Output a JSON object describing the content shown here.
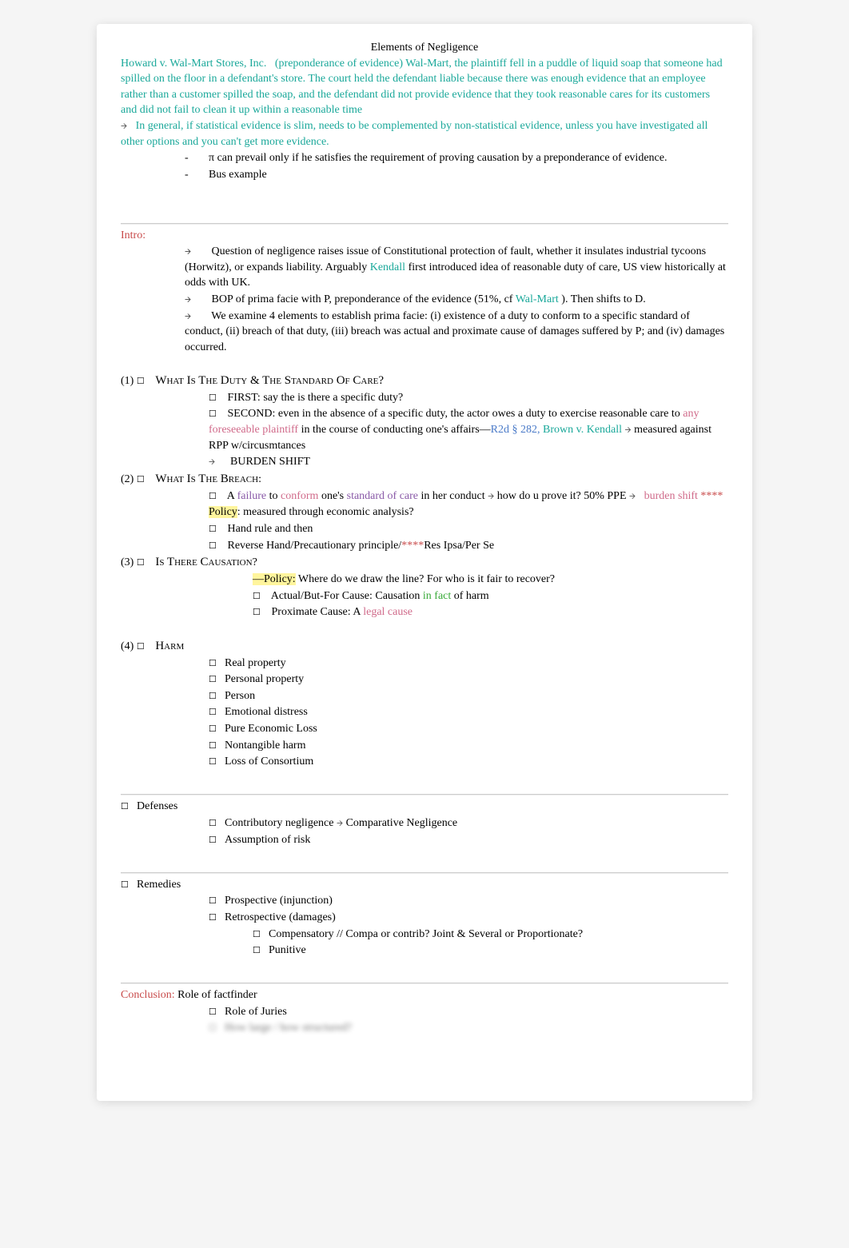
{
  "title": "Elements of Negligence",
  "case_lead": {
    "name": "Howard v. Wal-Mart Stores, Inc.",
    "tag": "(preponderance of evidence)",
    "body": "Wal-Mart, the plaintiff fell in a puddle of liquid soap that someone had spilled on the floor in a defendant's store. The court held the defendant liable because there was enough evidence that an employee rather than a customer spilled the soap, and the defendant did not provide evidence that they took reasonable cares for its customers and did not fail to clean it up within a reasonable time"
  },
  "teal_rule": "In general, if statistical evidence is slim, needs to be complemented by non-statistical evidence, unless you have investigated all other options and you can't get more evidence.",
  "dash_items": [
    "π can prevail only if he satisfies the requirement of proving causation by a preponderance of evidence.",
    "Bus example"
  ],
  "intro_label": "Intro:",
  "intro_items": {
    "i1a": "Question of negligence raises issue of Constitutional protection of fault, whether it insulates industrial tycoons (Horwitz), or expands liability. Arguably ",
    "kendall": "Kendall",
    "i1b": " first introduced idea of reasonable duty of care, US view historically at odds with UK.",
    "i2a": "BOP of prima facie with P, preponderance of the evidence (51%, cf ",
    "walmart": "Wal-Mart",
    "i2b": " ). Then shifts to D.",
    "i3": "We examine 4 elements to establish prima facie:  (i) existence of a duty to conform to a specific standard of conduct, (ii) breach of that duty, (iii) breach was actual and proximate cause of damages suffered by P; and (iv) damages occurred."
  },
  "s1": {
    "num": "(1)",
    "head": "What Is The Duty & The Standard Of Care",
    "q": "?",
    "first": "FIRST: say the is there a specific duty?",
    "sec_a": "SECOND: even in the absence of a specific duty, the actor owes a duty to exercise reasonable care  to ",
    "sec_link": "any foreseeable plaintiff",
    "sec_b": "   in the course of conducting one's affairs—",
    "r2d": "R2d § 282,",
    "brown": "Brown v. Kendall",
    "sec_c": "    measured against RPP w/circusmtances",
    "burden": "BURDEN SHIFT"
  },
  "s2": {
    "num": "(2)",
    "head": "What Is The Breach",
    "colon": ":",
    "a_pre": "A",
    "failure": " failure",
    "to": "  to ",
    "conform": "conform",
    "ones": "  one's ",
    "soc": "standard of care",
    "tail1": "    in her conduct ",
    "tail2": "   how do u prove it? 50% PPE ",
    "burden_shift": "burden shift",
    "stars": "  ****",
    "policy_label": "Policy",
    "policy_body": ": measured through economic analysis?",
    "hand": "Hand rule and then",
    "rev_a": "Reverse Hand/Precautionary principle/",
    "rev_stars": "****",
    "rev_b": "Res Ipsa/Per Se"
  },
  "s3": {
    "num": "(3)",
    "head": "Is There Causation",
    "q": "?",
    "policy_dash": "—",
    "policy_label": "Policy:",
    "policy_body": " Where do we draw the line? For who is it fair to recover?",
    "actual_a": "Actual/But-For Cause: Causation ",
    "infact": "in fact",
    "actual_b": "  of harm",
    "prox_a": "Proximate Cause: A ",
    "legal": "legal cause"
  },
  "s4": {
    "num": "(4)",
    "head": "Harm",
    "items": [
      "Real property",
      "Personal property",
      "Person",
      "Emotional distress",
      "Pure Economic Loss",
      "Nontangible harm",
      "Loss of Consortium"
    ]
  },
  "defenses": {
    "head": "Defenses",
    "line1a": "Contributory negligence ",
    "line1b": "    Comparative Negligence",
    "line2": "Assumption of risk"
  },
  "remedies": {
    "head": "Remedies",
    "p": "Prospective (injunction)",
    "r": "Retrospective (damages)",
    "c": "Compensatory // Compa or contrib? Joint & Several or Proportionate?",
    "pu": "Punitive"
  },
  "conclusion": {
    "label": "Conclusion:",
    "body": "  Role of factfinder",
    "juries": "Role of Juries",
    "blurred": "How large / how structured?"
  }
}
